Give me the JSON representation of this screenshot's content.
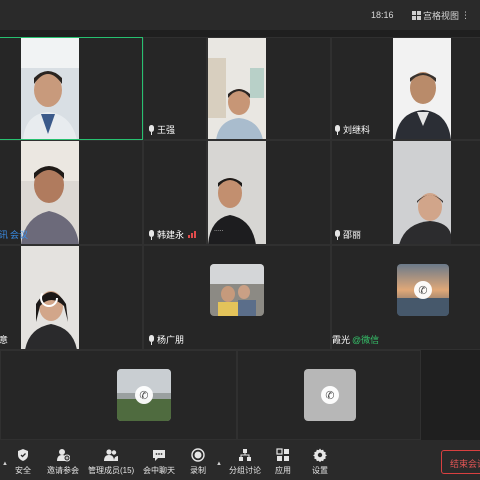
{
  "topbar": {
    "time": "18:16",
    "view_label": "宫格视图"
  },
  "participants": [
    {
      "id": "p1",
      "name": "",
      "has_mic": false,
      "video": "person",
      "active": true
    },
    {
      "id": "p2",
      "name": "王强",
      "has_mic": true,
      "video": "none"
    },
    {
      "id": "p3",
      "name": "",
      "has_mic": false,
      "video": "person"
    },
    {
      "id": "p4",
      "name": "刘继科",
      "has_mic": true,
      "video": "none"
    },
    {
      "id": "p5",
      "name": "",
      "has_mic": false,
      "video": "person"
    },
    {
      "id": "p6",
      "name_prefix": "讯",
      "name_suffix": "会议",
      "video": "person"
    },
    {
      "id": "p7",
      "name": "韩建永",
      "has_mic": true,
      "signal": true,
      "video": "none"
    },
    {
      "id": "p8",
      "name": "",
      "video": "person"
    },
    {
      "id": "p9",
      "name": "邵丽",
      "has_mic": true,
      "video": "none"
    },
    {
      "id": "p10",
      "name": "",
      "video": "person"
    },
    {
      "id": "p11",
      "name": "意",
      "video": "person"
    },
    {
      "id": "p12",
      "name": "杨广朋",
      "has_mic": true,
      "video": "avatar"
    },
    {
      "id": "p13",
      "name_prefix": "霞光",
      "name_suffix": "@微信",
      "video": "avatar"
    },
    {
      "id": "p14",
      "name": "",
      "video": "avatar"
    },
    {
      "id": "p15",
      "name": "",
      "video": "avatar"
    }
  ],
  "toolbar": {
    "items": [
      {
        "label": "安全",
        "icon": "shield-icon"
      },
      {
        "label": "邀请参会",
        "icon": "add-user-icon"
      },
      {
        "label": "管理成员(15)",
        "icon": "members-icon"
      },
      {
        "label": "会中聊天",
        "icon": "chat-icon"
      },
      {
        "label": "录制",
        "icon": "record-icon"
      },
      {
        "label": "分组讨论",
        "icon": "breakout-icon"
      },
      {
        "label": "应用",
        "icon": "apps-icon"
      },
      {
        "label": "设置",
        "icon": "gear-icon"
      }
    ],
    "end_label": "结束会议"
  },
  "colors": {
    "active_border": "#27c070",
    "end_red": "#d94040",
    "wechat_green": "#35c36a",
    "tencent_blue": "#3a8eea"
  }
}
